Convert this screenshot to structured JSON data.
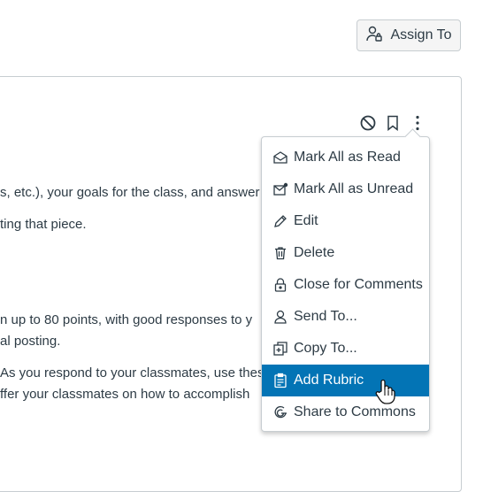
{
  "header": {
    "assign_to_label": "Assign To"
  },
  "toolbar": {
    "icons": [
      "unpublish-icon",
      "bookmark-icon",
      "more-options-icon"
    ]
  },
  "content": {
    "lines": [
      "s, etc.), your goals for the class, and answer",
      "ting that piece.",
      "n up to 80 points, with good responses to y",
      "al posting.",
      "As you respond to your classmates, use thes",
      "ffer your classmates on how to accomplish"
    ]
  },
  "menu": {
    "items": [
      {
        "label": "Mark All as Read",
        "icon": "envelope-open-icon"
      },
      {
        "label": "Mark All as Unread",
        "icon": "envelope-unread-icon"
      },
      {
        "label": "Edit",
        "icon": "pencil-icon"
      },
      {
        "label": "Delete",
        "icon": "trash-icon"
      },
      {
        "label": "Close for Comments",
        "icon": "lock-icon"
      },
      {
        "label": "Send To...",
        "icon": "user-icon"
      },
      {
        "label": "Copy To...",
        "icon": "copy-icon"
      },
      {
        "label": "Add Rubric",
        "icon": "rubric-icon"
      },
      {
        "label": "Share to Commons",
        "icon": "commons-icon"
      }
    ],
    "highlighted": "Add Rubric"
  },
  "colors": {
    "accent": "#0374b5",
    "text": "#2d3b45",
    "border": "#c7cdd1"
  }
}
